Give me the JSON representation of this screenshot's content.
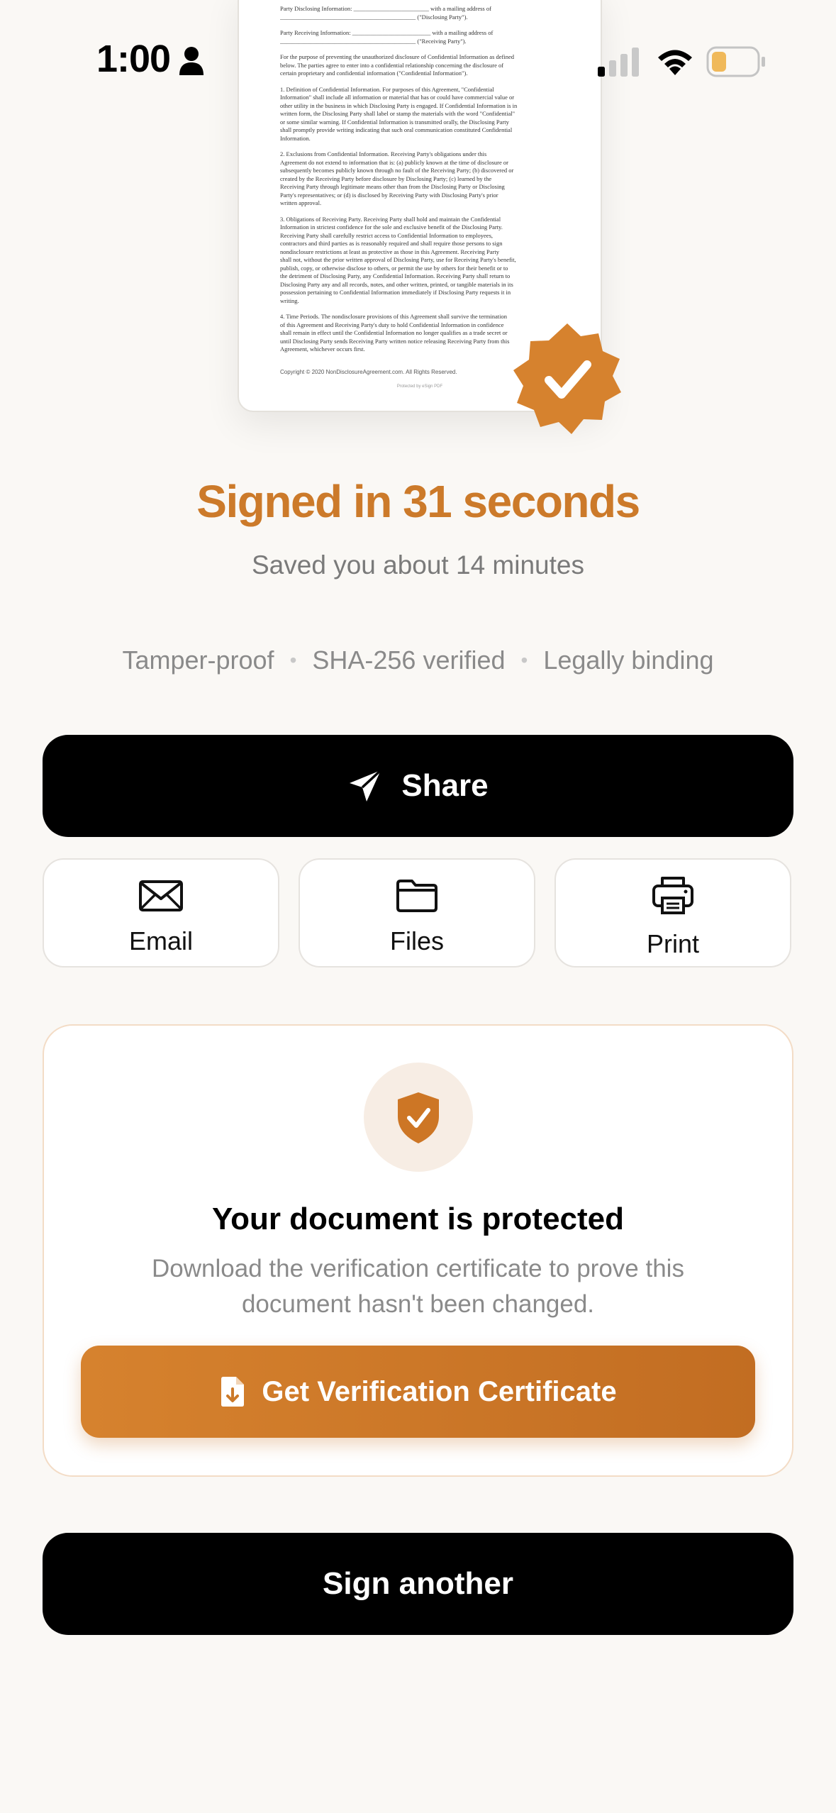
{
  "status_bar": {
    "time": "1:00"
  },
  "document": {
    "lines": [
      "Party Disclosing Information: _________________________ with a mailing address of",
      "_____________________________________________ (\"Disclosing Party\").",
      "",
      "Party Receiving Information: __________________________ with a mailing address of",
      "_____________________________________________ (\"Receiving Party\").",
      "",
      "For the purpose of preventing the unauthorized disclosure of Confidential Information as defined",
      "below. The parties agree to enter into a confidential relationship concerning the disclosure of",
      "certain proprietary and confidential information (\"Confidential Information\").",
      "",
      "1. Definition of Confidential Information. For purposes of this Agreement, \"Confidential",
      "Information\" shall include all information or material that has or could have commercial value or",
      "other utility in the business in which Disclosing Party is engaged. If Confidential Information is in",
      "written form, the Disclosing Party shall label or stamp the materials with the word \"Confidential\"",
      "or some similar warning. If Confidential Information is transmitted orally, the Disclosing Party",
      "shall promptly provide writing indicating that such oral communication constituted Confidential",
      "Information.",
      "",
      "2. Exclusions from Confidential Information. Receiving Party's obligations under this",
      "Agreement do not extend to information that is: (a) publicly known at the time of disclosure or",
      "subsequently becomes publicly known through no fault of the Receiving Party; (b) discovered or",
      "created by the Receiving Party before disclosure by Disclosing Party; (c) learned by the",
      "Receiving Party through legitimate means other than from the Disclosing Party or Disclosing",
      "Party's representatives; or (d) is disclosed by Receiving Party with Disclosing Party's prior",
      "written approval.",
      "",
      "3. Obligations of Receiving Party. Receiving Party shall hold and maintain the Confidential",
      "Information in strictest confidence for the sole and exclusive benefit of the Disclosing Party.",
      "Receiving Party shall carefully restrict access to Confidential Information to employees,",
      "contractors and third parties as is reasonably required and shall require those persons to sign",
      "nondisclosure restrictions at least as protective as those in this Agreement. Receiving Party",
      "shall not, without the prior written approval of Disclosing Party, use for Receiving Party's benefit,",
      "publish, copy, or otherwise disclose to others, or permit the use by others for their benefit or to",
      "the detriment of Disclosing Party, any Confidential Information. Receiving Party shall return to",
      "Disclosing Party any and all records, notes, and other written, printed, or tangible materials in its",
      "possession pertaining to Confidential Information immediately if Disclosing Party requests it in",
      "writing.",
      "",
      "4. Time Periods. The nondisclosure provisions of this Agreement shall survive the termination",
      "of this Agreement and Receiving Party's duty to hold Confidential Information in confidence",
      "shall remain in effect until the Confidential Information no longer qualifies as a trade secret or",
      "until Disclosing Party sends Receiving Party written notice releasing Receiving Party from this",
      "Agreement, whichever occurs first."
    ],
    "footer": "Copyright © 2020 NonDisclosureAgreement.com. All Rights Reserved.",
    "protected_by": "Protected by eSign PDF"
  },
  "result": {
    "headline": "Signed in 31 seconds",
    "subline": "Saved you about 14 minutes",
    "features": [
      "Tamper-proof",
      "SHA-256 verified",
      "Legally binding"
    ]
  },
  "actions": {
    "share_label": "Share",
    "email_label": "Email",
    "files_label": "Files",
    "print_label": "Print"
  },
  "protection": {
    "title": "Your document is protected",
    "description": "Download the verification certificate to prove this document hasn't been changed.",
    "cert_button_label": "Get Verification Certificate"
  },
  "sign_another_label": "Sign another",
  "colors": {
    "accent": "#cc7a2a",
    "primary_button": "#000000",
    "background": "#faf8f5"
  }
}
